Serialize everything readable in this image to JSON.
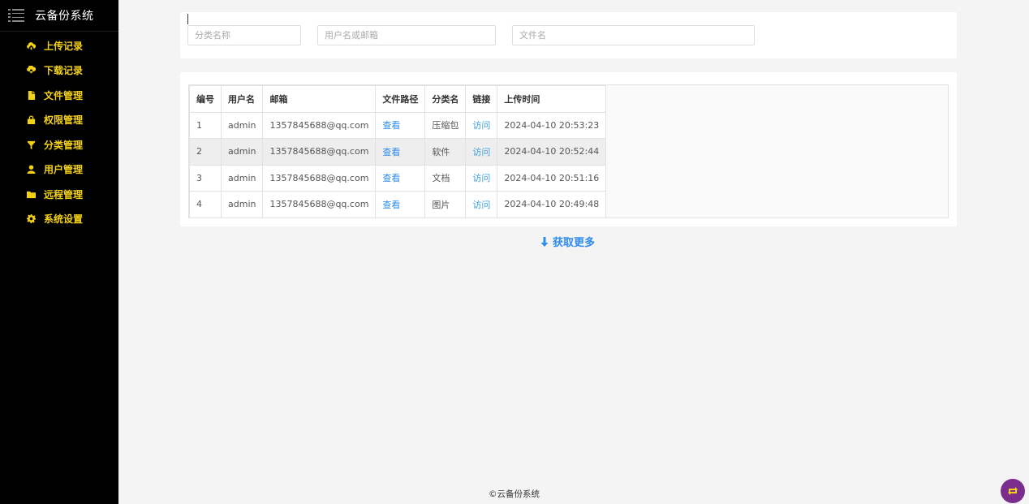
{
  "app": {
    "title": "云备份系统"
  },
  "sidebar": {
    "items": [
      {
        "label": "上传记录",
        "icon": "cloud-upload-icon"
      },
      {
        "label": "下载记录",
        "icon": "cloud-download-icon"
      },
      {
        "label": "文件管理",
        "icon": "file-icon"
      },
      {
        "label": "权限管理",
        "icon": "lock-icon"
      },
      {
        "label": "分类管理",
        "icon": "filter-icon"
      },
      {
        "label": "用户管理",
        "icon": "user-icon"
      },
      {
        "label": "远程管理",
        "icon": "folder-icon"
      },
      {
        "label": "系统设置",
        "icon": "gear-icon"
      }
    ]
  },
  "search": {
    "category_placeholder": "分类名称",
    "user_placeholder": "用户名或邮箱",
    "file_placeholder": "文件名"
  },
  "table": {
    "headers": [
      "编号",
      "用户名",
      "邮箱",
      "文件路径",
      "分类名",
      "链接",
      "上传时间"
    ],
    "rows": [
      {
        "id": "1",
        "username": "admin",
        "email": "1357845688@qq.com",
        "path": "查看",
        "category": "压缩包",
        "link": "访问",
        "time": "2024-04-10 20:53:23"
      },
      {
        "id": "2",
        "username": "admin",
        "email": "1357845688@qq.com",
        "path": "查看",
        "category": "软件",
        "link": "访问",
        "time": "2024-04-10 20:52:44"
      },
      {
        "id": "3",
        "username": "admin",
        "email": "1357845688@qq.com",
        "path": "查看",
        "category": "文档",
        "link": "访问",
        "time": "2024-04-10 20:51:16"
      },
      {
        "id": "4",
        "username": "admin",
        "email": "1357845688@qq.com",
        "path": "查看",
        "category": "图片",
        "link": "访问",
        "time": "2024-04-10 20:49:48"
      }
    ]
  },
  "load_more": {
    "label": "获取更多"
  },
  "footer": {
    "text": "©云备份系统"
  },
  "colors": {
    "sidebar_bg": "#000000",
    "nav_text": "#f3d116",
    "link": "#2d8cf0",
    "float_button": "#7b2d8e"
  }
}
